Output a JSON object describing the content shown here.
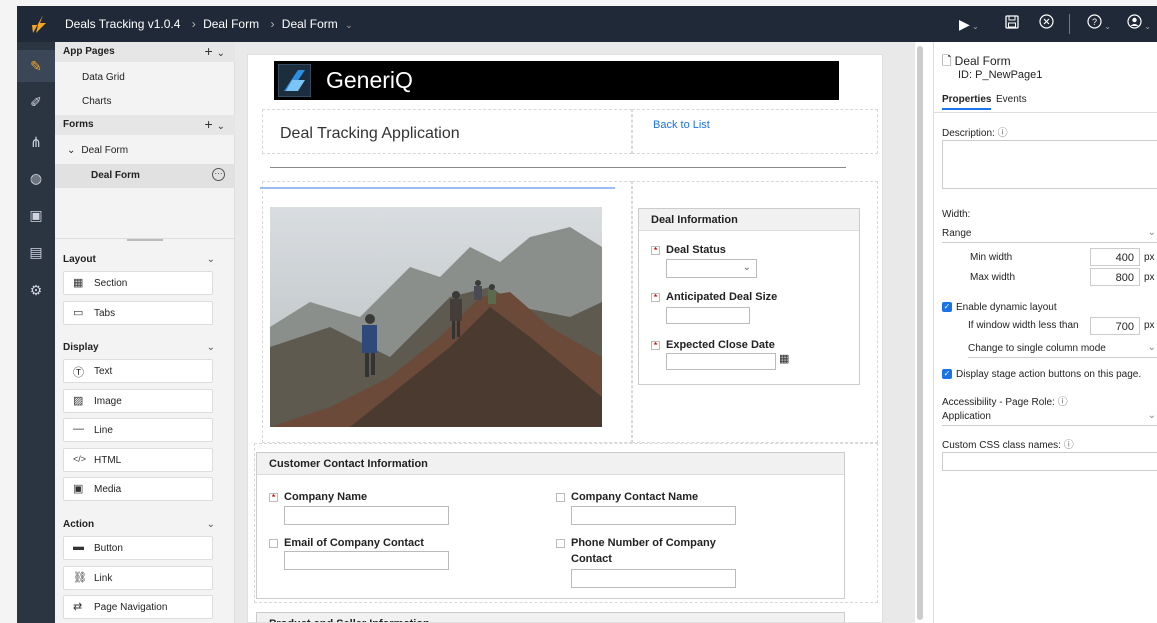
{
  "topbar": {
    "app": "Deals Tracking v1.0.4",
    "crumb1": "Deal Form",
    "crumb2": "Deal Form",
    "icons": [
      "play-icon",
      "save-icon",
      "close-circle-icon",
      "help-icon",
      "user-icon"
    ]
  },
  "left": {
    "app_pages": "App Pages",
    "pages": [
      "Data Grid",
      "Charts"
    ],
    "forms": "Forms",
    "form_group": "Deal Form",
    "form_item": "Deal Form",
    "layout": "Layout",
    "layout_items": [
      "Section",
      "Tabs"
    ],
    "display": "Display",
    "display_items": [
      "Text",
      "Image",
      "Line",
      "HTML",
      "Media"
    ],
    "action": "Action",
    "action_items": [
      "Button",
      "Link",
      "Page Navigation"
    ]
  },
  "form": {
    "logo_text": "GeneriQ",
    "app_title": "Deal Tracking Application",
    "back_link": "Back to List",
    "deal_info": "Deal Information",
    "deal_status": "Deal Status",
    "deal_size": "Anticipated Deal Size",
    "close_date": "Expected Close Date",
    "customer_title": "Customer Contact Information",
    "company_name": "Company Name",
    "company_contact": "Company Contact Name",
    "email": "Email of Company Contact",
    "phone1": "Phone Number of Company",
    "phone2": "Contact",
    "product_title": "Product and Seller Information"
  },
  "right": {
    "title": "Deal Form",
    "id": "ID: P_NewPage1",
    "tab_properties": "Properties",
    "tab_events": "Events",
    "description": "Description:",
    "width": "Width:",
    "width_mode": "Range",
    "min_width_label": "Min width",
    "min_width": "400",
    "max_width_label": "Max width",
    "max_width": "800",
    "px": "px",
    "dynamic": "Enable dynamic layout",
    "if_less": "If window width less than",
    "if_less_val": "700",
    "change_mode": "Change to single column mode",
    "display_stage": "Display stage action buttons on this page.",
    "accessibility": "Accessibility - Page Role:",
    "role": "Application",
    "css": "Custom CSS class names:"
  },
  "colors": {
    "topbar": "#1f2937",
    "accent": "#1a73e8",
    "rail": "#2b3441"
  }
}
